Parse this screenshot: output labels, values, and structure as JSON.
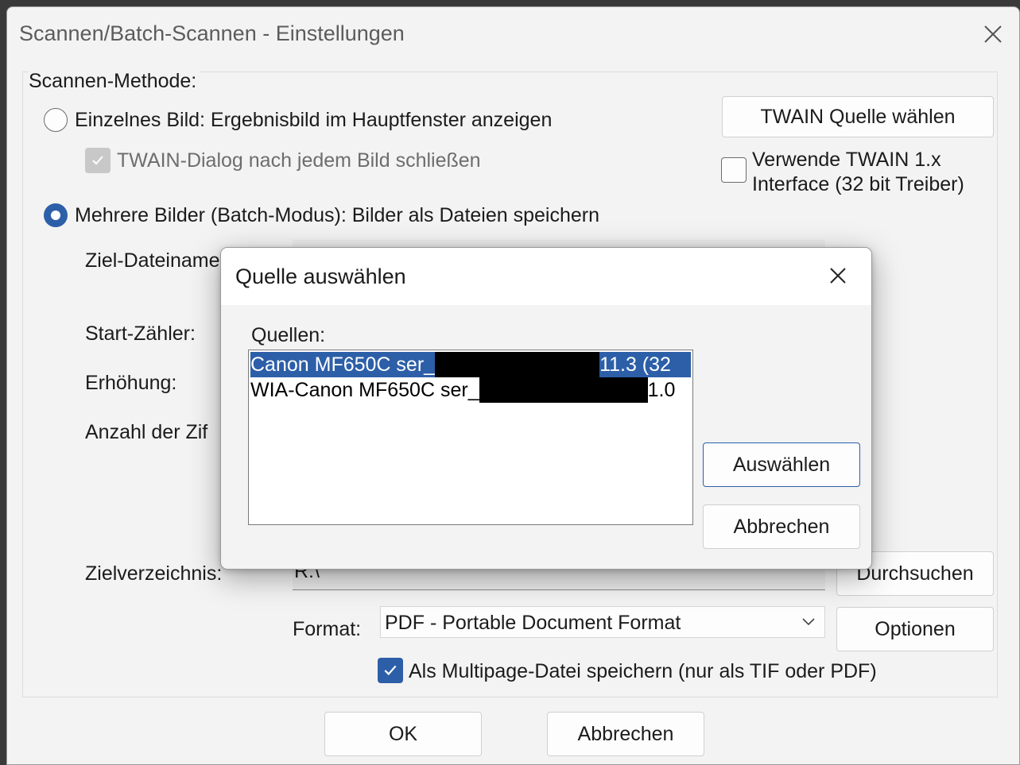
{
  "main": {
    "title": "Scannen/Batch-Scannen - Einstellungen",
    "group_label": "Scannen-Methode:",
    "single_radio_label": "Einzelnes Bild: Ergebnisbild im Hauptfenster anzeigen",
    "twain_close_label": "TWAIN-Dialog nach jedem Bild schließen",
    "batch_radio_label": "Mehrere Bilder (Batch-Modus): Bilder als Dateien speichern",
    "twain_source_button": "TWAIN Quelle wählen",
    "twain1x_label_line1": "Verwende TWAIN 1.x",
    "twain1x_label_line2": "Interface (32 bit Treiber)",
    "target_filename_label": "Ziel-Dateiname",
    "start_counter_label": "Start-Zähler:",
    "increment_label": "Erhöhung:",
    "digits_label": "Anzahl der Zif",
    "target_dir_label": "Zielverzeichnis:",
    "target_dir_value": "R:\\",
    "browse_button": "Durchsuchen",
    "format_label": "Format:",
    "format_value": "PDF - Portable Document Format",
    "options_button": "Optionen",
    "multipage_label": "Als Multipage-Datei speichern (nur als TIF oder PDF)",
    "ok_button": "OK",
    "cancel_button": "Abbrechen"
  },
  "modal": {
    "title": "Quelle auswählen",
    "sources_label": "Quellen:",
    "sources": [
      {
        "prefix": "Canon MF650C ser_",
        "suffix": "11.3 (32",
        "selected": true
      },
      {
        "prefix": "WIA-Canon MF650C ser_",
        "suffix": "1.0",
        "selected": false
      }
    ],
    "select_button": "Auswählen",
    "cancel_button": "Abbrechen"
  },
  "icons": {
    "close": "close-icon",
    "chevron": "chevron-down-icon",
    "check": "check-icon"
  },
  "colors": {
    "accent": "#2d5fa8",
    "window_bg": "#f3f3f3"
  }
}
